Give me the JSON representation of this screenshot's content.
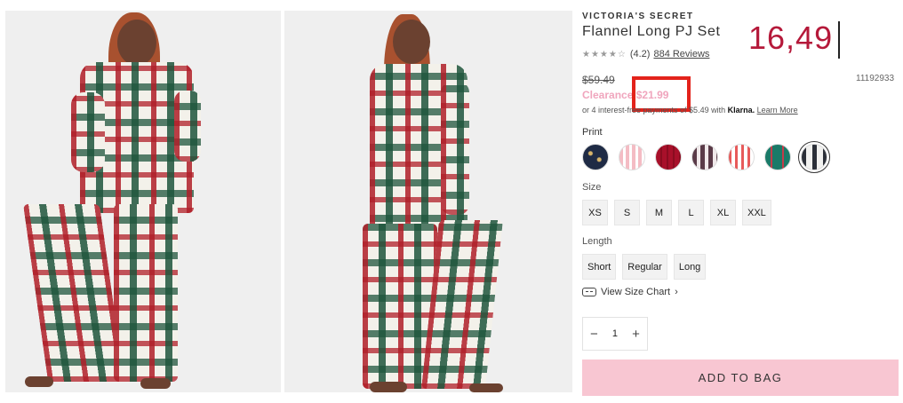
{
  "product": {
    "brand": "VICTORIA'S SECRET",
    "title": "Flannel Long PJ Set",
    "rating_stars": "★★★★☆",
    "rating_value": "(4.2)",
    "reviews_label": "884 Reviews",
    "original_price": "$59.49",
    "sku": "11192933",
    "clearance_label": "Clearance",
    "sale_price": "$21.99",
    "klarna_prefix": "or 4 interest-free payments of $5.49 with",
    "klarna_brand": "Klarna.",
    "klarna_link": "Learn More"
  },
  "annotation": {
    "value": "16,49",
    "color": "#b5193a",
    "box_color": "#e3231b"
  },
  "options": {
    "print_label": "Print",
    "swatches": [
      "navy-gold-dot",
      "pink-stripe",
      "red-plaid",
      "mauve-plaid",
      "coral-gingham",
      "green-plaid",
      "black-white-plaid"
    ],
    "selected_swatch": "black-white-plaid",
    "size_label": "Size",
    "sizes": [
      "XS",
      "S",
      "M",
      "L",
      "XL",
      "XXL"
    ],
    "length_label": "Length",
    "lengths": [
      "Short",
      "Regular",
      "Long"
    ],
    "size_chart_label": "View Size Chart",
    "size_chart_chevron": "›"
  },
  "quantity": {
    "minus": "−",
    "value": "1",
    "plus": "+"
  },
  "cta": {
    "add_to_bag": "ADD TO BAG",
    "color": "#f8c6d2"
  }
}
